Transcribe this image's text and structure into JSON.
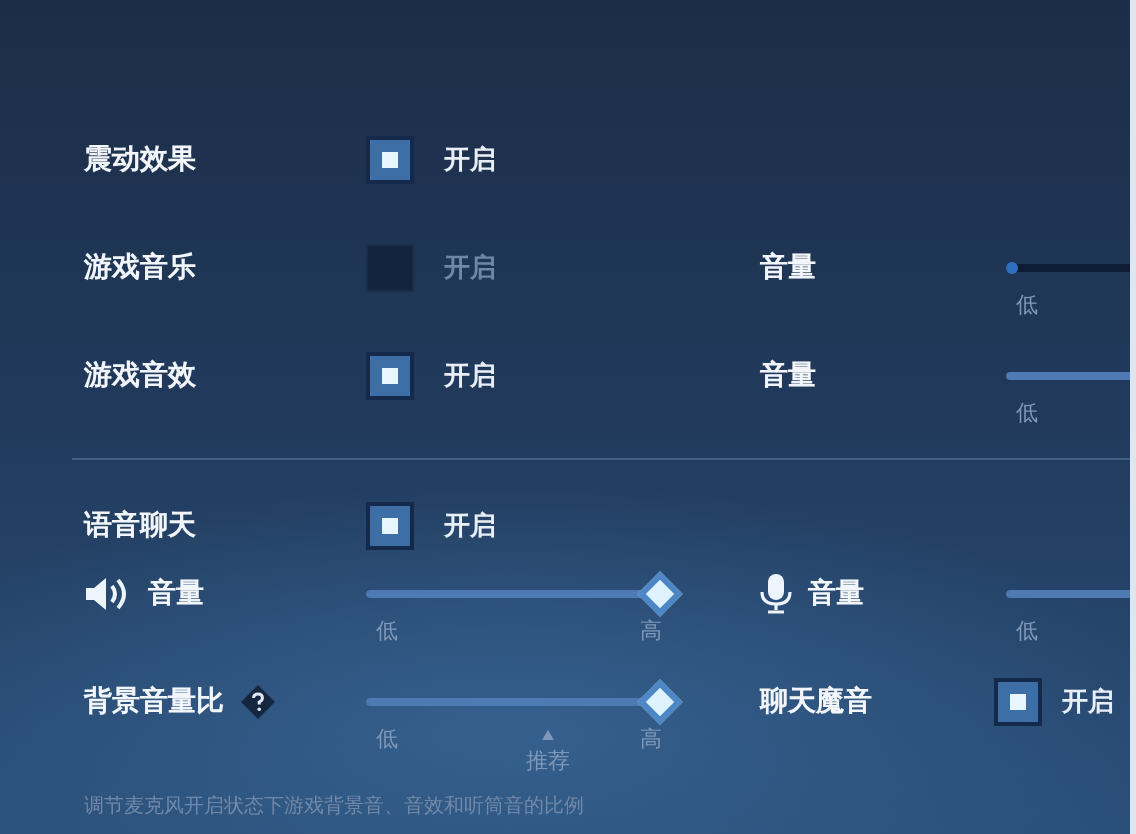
{
  "rows": [
    {
      "label": "震动效果",
      "control": {
        "kind": "toggle",
        "checked": true,
        "label": "开启"
      }
    },
    {
      "label": "游戏音乐",
      "control": {
        "kind": "toggle",
        "checked": false,
        "label": "开启"
      },
      "right": {
        "label": "音量",
        "control": {
          "kind": "slider",
          "level": 0,
          "disabled": true,
          "low": "低"
        }
      }
    },
    {
      "label": "游戏音效",
      "control": {
        "kind": "toggle",
        "checked": true,
        "label": "开启"
      },
      "right": {
        "label": "音量",
        "control": {
          "kind": "slider",
          "disabled": false,
          "low": "低"
        }
      }
    },
    {
      "divider": true,
      "label": "语音聊天",
      "control": {
        "kind": "toggle",
        "checked": true,
        "label": "开启"
      }
    },
    {
      "label": "音量",
      "control": {
        "kind": "slider",
        "level": 1,
        "disabled": false,
        "low": "低",
        "high": "高"
      },
      "right": {
        "label": "音量",
        "control": {
          "kind": "slider",
          "disabled": false,
          "low": "低"
        }
      }
    },
    {
      "label": "背景音量比",
      "help": true,
      "control": {
        "kind": "slider",
        "level": 1,
        "disabled": false,
        "low": "低",
        "high": "高",
        "recommended": "推荐"
      },
      "right": {
        "label": "聊天魔音",
        "control": {
          "kind": "toggle",
          "checked": true,
          "label": "开启"
        }
      }
    }
  ],
  "footnote": "调节麦克风开启状态下游戏背景音、音效和听筒音的比例"
}
